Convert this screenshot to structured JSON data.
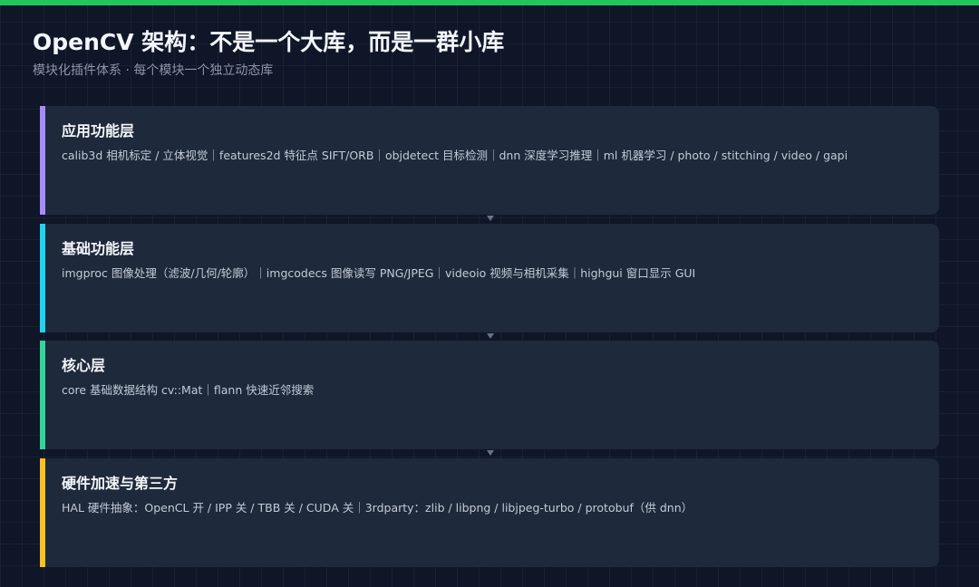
{
  "header": {
    "title": "OpenCV 架构：不是一个大库，而是一群小库",
    "subtitle": "模块化插件体系 · 每个模块一个独立动态库"
  },
  "colors": {
    "accent_bar": "#22c55e",
    "card_bg": "#1e293b",
    "background": "#0f1628",
    "connector": "#64748b"
  },
  "layers": [
    {
      "title": "应用功能层",
      "description": "calib3d 相机标定 / 立体视觉｜features2d 特征点 SIFT/ORB｜objdetect 目标检测｜dnn 深度学习推理｜ml 机器学习 / photo / stitching / video / gapi",
      "color": "#a78bfa"
    },
    {
      "title": "基础功能层",
      "description": "imgproc 图像处理（滤波/几何/轮廓）｜imgcodecs 图像读写 PNG/JPEG｜videoio 视频与相机采集｜highgui 窗口显示 GUI",
      "color": "#22d3ee"
    },
    {
      "title": "核心层",
      "description": "core 基础数据结构 cv::Mat｜flann 快速近邻搜索",
      "color": "#34d399"
    },
    {
      "title": "硬件加速与第三方",
      "description": "HAL 硬件抽象：OpenCL 开 / IPP 关 / TBB 关 / CUDA 关｜3rdparty：zlib / libpng / libjpeg-turbo / protobuf（供 dnn）",
      "color": "#fbbf24"
    }
  ]
}
